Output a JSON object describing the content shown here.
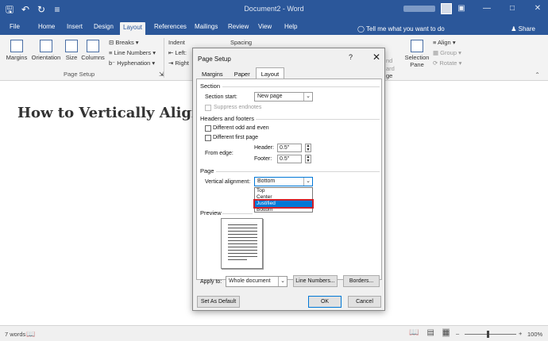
{
  "window": {
    "title": "Document2 - Word",
    "qat_icons": [
      "save-icon",
      "undo-icon",
      "redo-icon",
      "customize-qat-icon"
    ],
    "controls": [
      "ribbon-display-icon",
      "minimize-icon",
      "maximize-icon",
      "close-icon"
    ]
  },
  "tabs": [
    "File",
    "Home",
    "Insert",
    "Design",
    "Layout",
    "References",
    "Mailings",
    "Review",
    "View",
    "Help"
  ],
  "active_tab": "Layout",
  "tell_me": "Tell me what you want to do",
  "share": "Share",
  "ribbon": {
    "margins": "Margins",
    "orientation": "Orientation",
    "size": "Size",
    "columns": "Columns",
    "breaks": "Breaks",
    "line_numbers": "Line Numbers",
    "hyphenation": "Hyphenation",
    "page_setup_group": "Page Setup",
    "indent": "Indent",
    "left": "Left:",
    "right": "Right",
    "spacing": "Spacing",
    "selection_pane": "Selection Pane",
    "align": "Align",
    "group": "Group",
    "rotate": "Rotate",
    "fwd": "ard",
    "ge": "ge",
    "nd": "nd"
  },
  "document": {
    "heading": "How to Vertically Align"
  },
  "status": {
    "words": "7 words",
    "zoom": "100%",
    "zoom_minus": "–",
    "zoom_plus": "+"
  },
  "dialog": {
    "title": "Page Setup",
    "help": "?",
    "close": "✕",
    "tabs": [
      "Margins",
      "Paper",
      "Layout"
    ],
    "active_tab": "Layout",
    "section_heading": "Section",
    "section_start_label": "Section start:",
    "section_start_value": "New page",
    "suppress_endnotes": "Suppress endnotes",
    "headers_heading": "Headers and footers",
    "diff_odd_even": "Different odd and even",
    "diff_first_page": "Different first page",
    "from_edge": "From edge:",
    "header_label": "Header:",
    "header_value": "0.5\"",
    "footer_label": "Footer:",
    "footer_value": "0.5\"",
    "page_heading": "Page",
    "vertical_alignment_label": "Vertical alignment:",
    "vertical_alignment_value": "Bottom",
    "vertical_alignment_options": [
      "Top",
      "Center",
      "Justified",
      "Bottom"
    ],
    "highlighted_option": "Justified",
    "preview_heading": "Preview",
    "apply_to_label": "Apply to:",
    "apply_to_value": "Whole document",
    "line_numbers_btn": "Line Numbers...",
    "borders_btn": "Borders...",
    "set_default_btn": "Set As Default",
    "ok_btn": "OK",
    "cancel_btn": "Cancel"
  }
}
